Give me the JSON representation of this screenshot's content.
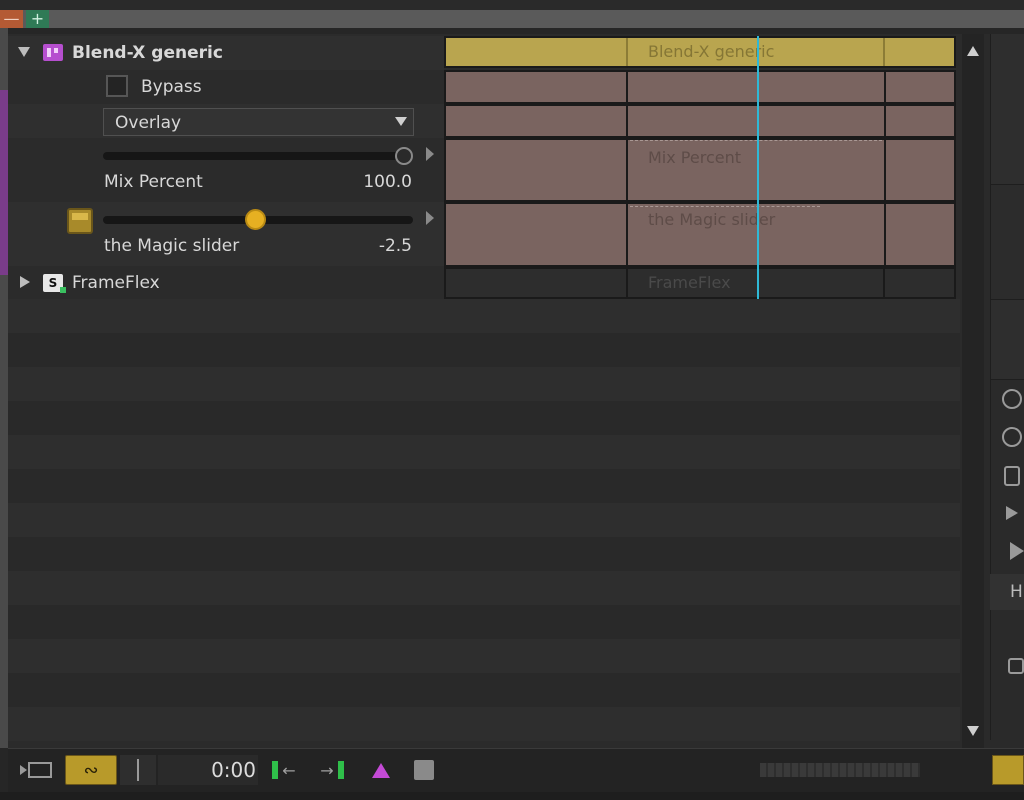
{
  "tabs": {
    "minus_label": "—",
    "plus_label": "+"
  },
  "track": {
    "name": "Blend-X generic",
    "bypass_label": "Bypass",
    "mode_selected": "Overlay",
    "mix_label": "Mix Percent",
    "mix_value": "100.0",
    "mix_level": 1.0,
    "magic_label": "the Magic slider",
    "magic_value": "-2.5",
    "magic_level": 0.49
  },
  "track2": {
    "name": "FrameFlex"
  },
  "clips": {
    "header_label": "Blend-X generic",
    "mix_label": "Mix Percent",
    "magic_label": "the Magic slider",
    "frameflex_label": "FrameFlex"
  },
  "transport": {
    "time": "0:00"
  },
  "right_panel": {
    "label": "H"
  },
  "colors": {
    "accent_gold": "#d9a72c",
    "clip_header": "#b9a54f",
    "playhead": "#2fb9d6",
    "purple_strip": "#7a3c8a"
  }
}
